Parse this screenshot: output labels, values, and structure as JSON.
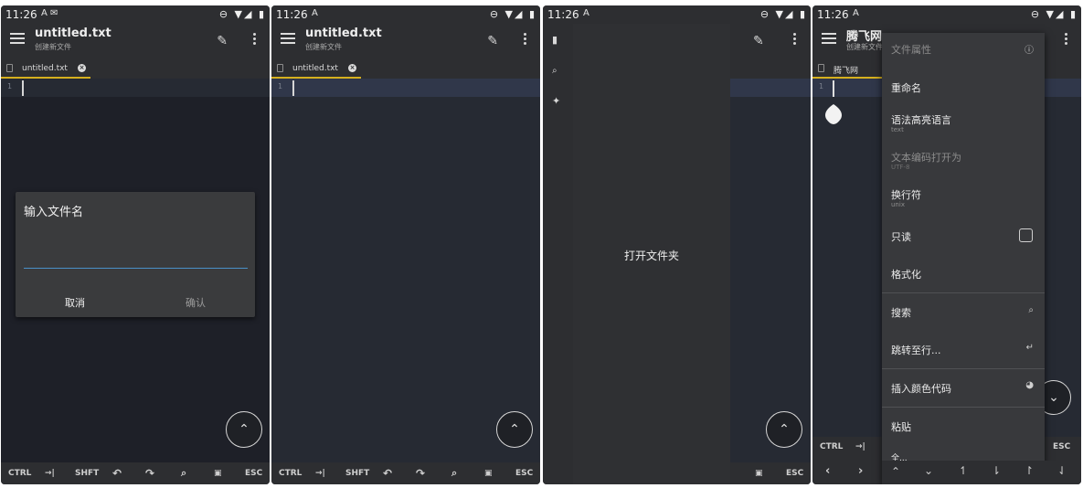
{
  "status": {
    "time": "11:26",
    "notif1": "A ✉",
    "notif2": "A",
    "right_icons": "⊖ ▼◢ ▮"
  },
  "app": {
    "file_title": "untitled.txt",
    "file_subtitle": "创建新文件",
    "tab_label": "untitled.txt",
    "line_number": "1"
  },
  "app4": {
    "title": "腾飞网",
    "subtitle": "创建新文件",
    "tab_label": "腾飞网",
    "line_number": "1"
  },
  "dialog": {
    "title": "输入文件名",
    "input_value": "",
    "cancel_label": "取消",
    "confirm_label": "确认"
  },
  "bottom_bar": {
    "ctrl": "CTRL",
    "tab_glyph": "→|",
    "shift": "SHFT",
    "undo": "↶",
    "redo": "↷",
    "search": "⌕",
    "save": "▣",
    "esc": "ESC"
  },
  "drawer": {
    "open_folder": "打开文件夹"
  },
  "fab": {
    "glyph": "⌃"
  },
  "menu": {
    "file_properties": "文件属性",
    "rename": "重命名",
    "syntax_language": "语法高亮语言",
    "syntax_value": "text",
    "open_encoding": "文本编码打开为",
    "encoding_value": "UTF-8",
    "line_ending": "换行符",
    "line_ending_value": "unix",
    "read_only": "只读",
    "format": "格式化",
    "search": "搜索",
    "goto_line": "跳转至行...",
    "insert_color": "插入颜色代码",
    "paste": "粘贴",
    "truncated": "全..."
  },
  "bottom_bar4": {
    "ctrl": "CTRL",
    "tab_glyph": "→|",
    "esc": "ESC",
    "left": "‹",
    "right": "›",
    "up": "⌃",
    "down": "⌄",
    "sel1": "↿",
    "sel2": "⇂",
    "sel3": "↾",
    "sel4": "⇃"
  },
  "colors": {
    "accent_tab_underline": "#d6b01e",
    "editor_bg": "#262a33",
    "current_line": "#30374a",
    "input_underline": "#4a90c8"
  }
}
